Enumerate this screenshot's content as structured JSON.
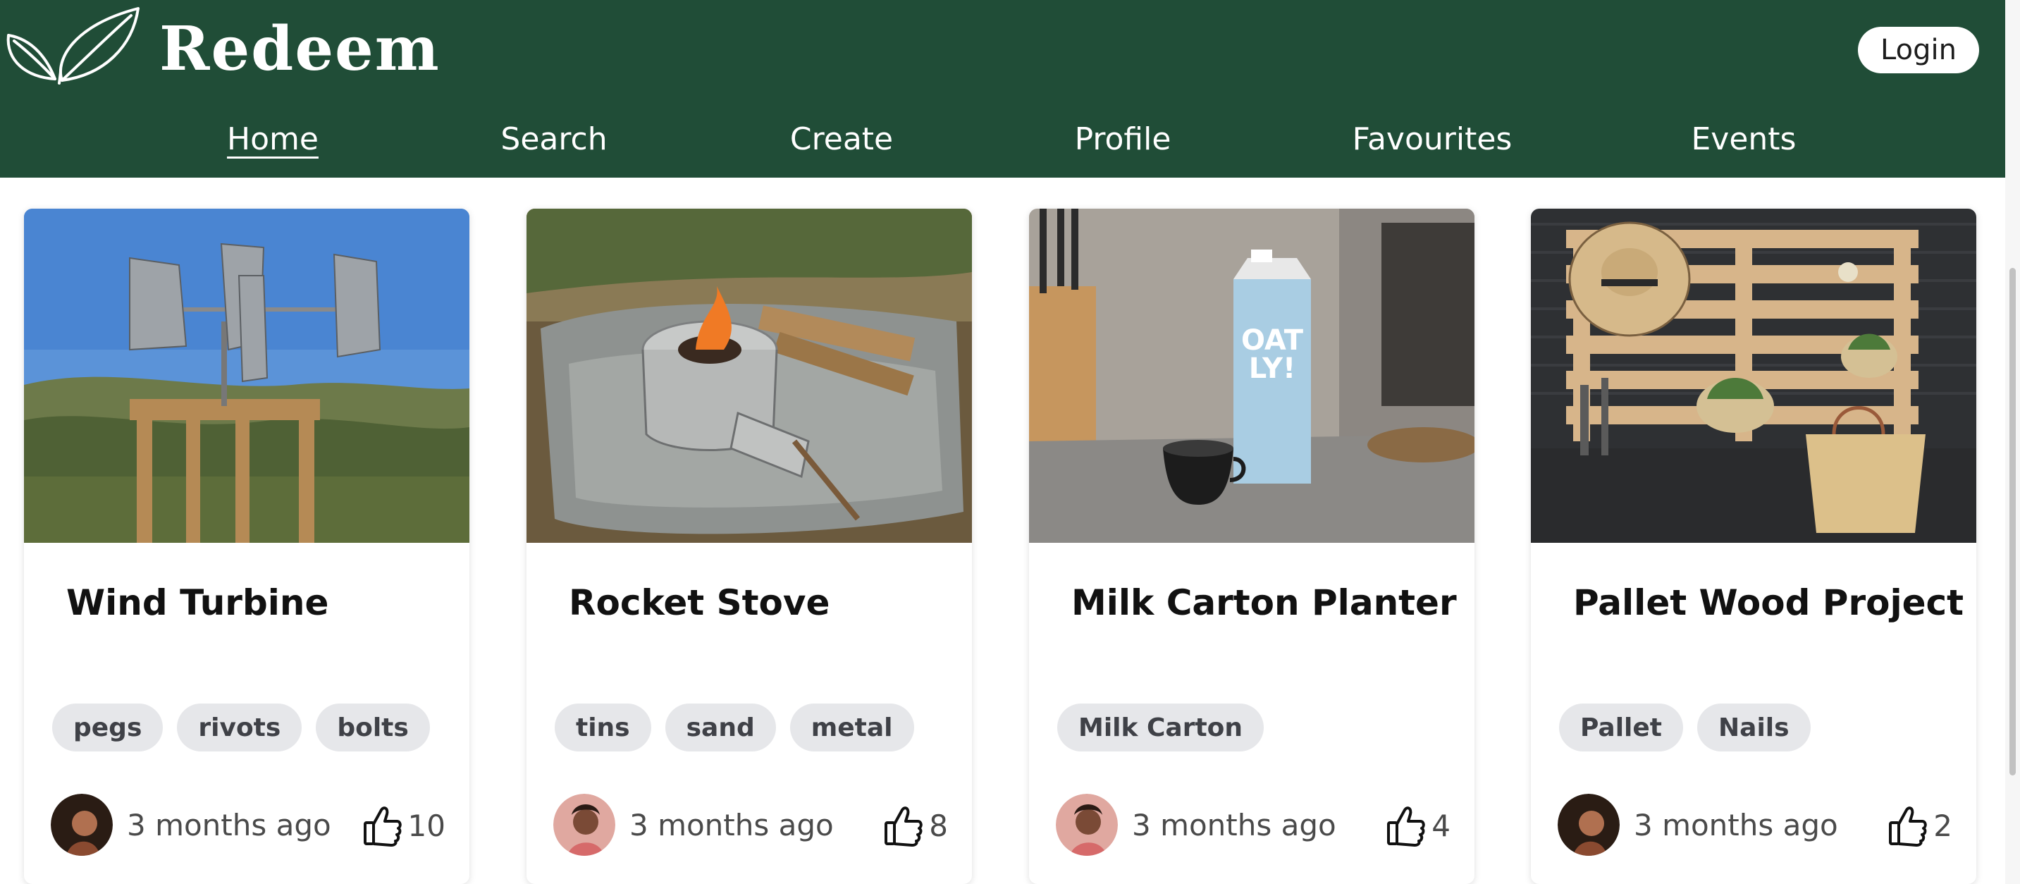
{
  "header": {
    "brand": "Redeem",
    "login_label": "Login",
    "colors": {
      "header_bg": "#204d37",
      "text": "#ffffff"
    }
  },
  "nav": {
    "items": [
      {
        "label": "Home",
        "active": true
      },
      {
        "label": "Search",
        "active": false
      },
      {
        "label": "Create",
        "active": false
      },
      {
        "label": "Profile",
        "active": false
      },
      {
        "label": "Favourites",
        "active": false
      },
      {
        "label": "Events",
        "active": false
      }
    ]
  },
  "cards": [
    {
      "title": "Wind Turbine",
      "tags": [
        "pegs",
        "rivots",
        "bolts"
      ],
      "time": "3 months ago",
      "likes": "10",
      "image": "wind-turbine-photo",
      "avatar": "avatar-user-1"
    },
    {
      "title": "Rocket Stove",
      "tags": [
        "tins",
        "sand",
        "metal"
      ],
      "time": "3 months ago",
      "likes": "8",
      "image": "rocket-stove-photo",
      "avatar": "avatar-user-2"
    },
    {
      "title": "Milk Carton Planter",
      "tags": [
        "Milk Carton"
      ],
      "time": "3 months ago",
      "likes": "4",
      "image": "milk-carton-photo",
      "avatar": "avatar-user-2"
    },
    {
      "title": "Pallet Wood Project",
      "tags": [
        "Pallet",
        "Nails"
      ],
      "time": "3 months ago",
      "likes": "2",
      "image": "pallet-wood-photo",
      "avatar": "avatar-user-1"
    }
  ]
}
